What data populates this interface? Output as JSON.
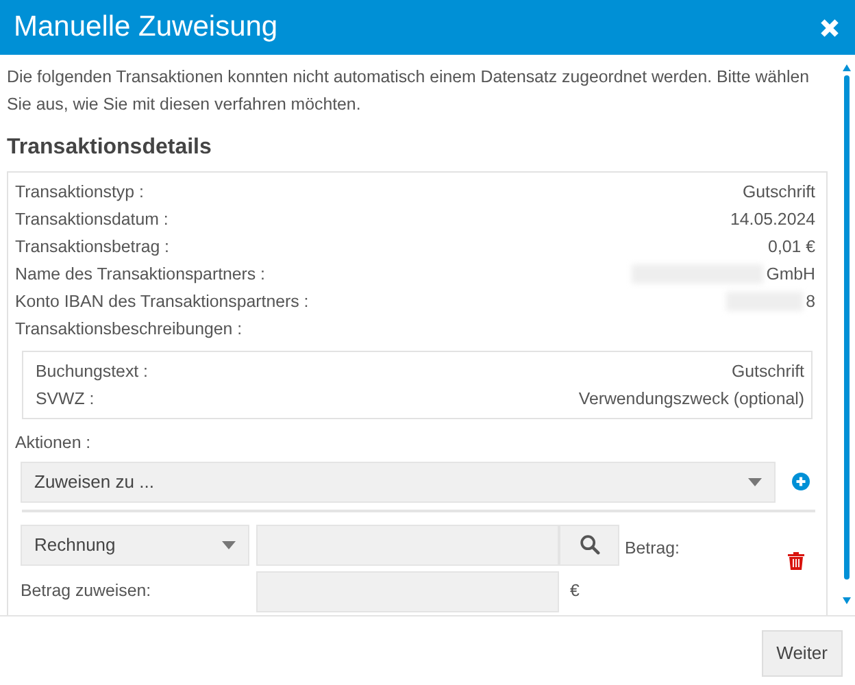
{
  "window": {
    "title": "Manuelle Zuweisung"
  },
  "intro": "Die folgenden Transaktionen konnten nicht automatisch einem Datensatz zugeordnet werden. Bitte wählen Sie aus, wie Sie mit diesen verfahren möchten.",
  "section_title": "Transaktionsdetails",
  "details": [
    {
      "label": "Transaktionstyp :",
      "value": "Gutschrift",
      "redacted": false
    },
    {
      "label": "Transaktionsdatum :",
      "value": "14.05.2024",
      "redacted": false
    },
    {
      "label": "Transaktionsbetrag :",
      "value": "0,01 €",
      "redacted": false
    },
    {
      "label": "Name des Transaktionspartners :",
      "value": "GmbH",
      "redacted": true
    },
    {
      "label": "Konto IBAN des Transaktionspartners :",
      "value": "8",
      "redacted": true
    },
    {
      "label": "Transaktionsbeschreibungen :"
    }
  ],
  "descriptions": [
    {
      "label": "Buchungstext :",
      "value": "Gutschrift"
    },
    {
      "label": "SVWZ :",
      "value": "Verwendungszweck (optional)"
    }
  ],
  "actions": {
    "label": "Aktionen :",
    "assign_select": "Zuweisen zu ...",
    "type_select": "Rechnung",
    "amount_label": "Betrag:",
    "assign_amount_label": "Betrag zuweisen:",
    "currency": "€"
  },
  "buttons": [
    "Weiter"
  ]
}
